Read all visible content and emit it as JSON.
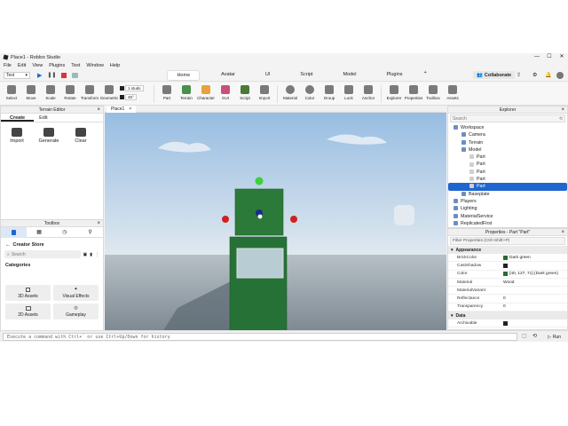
{
  "window": {
    "title": "Place1 - Roblox Studio",
    "controls": [
      "—",
      "☐",
      "✕"
    ]
  },
  "menu": [
    "File",
    "Edit",
    "View",
    "Plugins",
    "Test",
    "Window",
    "Help"
  ],
  "topbar": {
    "mode_select": "Test",
    "tabs": [
      "Home",
      "Avatar",
      "UI",
      "Script",
      "Model",
      "Plugins"
    ],
    "active_tab": "Home",
    "collaborate": "Collaborate"
  },
  "ribbon": {
    "transform_tools": [
      "Select",
      "Move",
      "Scale",
      "Rotate",
      "Transform",
      "Geometric"
    ],
    "snap_move": "1 studs",
    "snap_rotate": "45°",
    "insert_tools": [
      "Part",
      "Terrain",
      "Character",
      "GUI",
      "Script",
      "Import"
    ],
    "edit_tools": [
      "Material",
      "Color",
      "Group",
      "Lock",
      "Anchor"
    ],
    "panels": [
      "Explorer",
      "Properties",
      "Toolbox",
      "Assets"
    ]
  },
  "terrain_editor": {
    "title": "Terrain Editor",
    "tabs": [
      "Create",
      "Edit"
    ],
    "active_tab": "Create",
    "tools": [
      "Import",
      "Generate",
      "Clear"
    ]
  },
  "viewport": {
    "tab": "Place1",
    "sky_color": "#bcd3ea",
    "floor_color": "#8e9aa3",
    "part_color": "#286c2f"
  },
  "toolbox": {
    "title": "Toolbox",
    "store_title": "Creator Store",
    "search_placeholder": "Search",
    "categories_label": "Categories",
    "categories": [
      "3D Assets",
      "Visual Effects",
      "2D Assets",
      "Gameplay"
    ]
  },
  "explorer": {
    "title": "Explorer",
    "search_placeholder": "Search",
    "tree": [
      {
        "label": "Workspace",
        "depth": 0
      },
      {
        "label": "Camera",
        "depth": 1
      },
      {
        "label": "Terrain",
        "depth": 1
      },
      {
        "label": "Model",
        "depth": 1
      },
      {
        "label": "Part",
        "depth": 2
      },
      {
        "label": "Part",
        "depth": 2
      },
      {
        "label": "Part",
        "depth": 2
      },
      {
        "label": "Part",
        "depth": 2
      },
      {
        "label": "Part",
        "depth": 2,
        "selected": true
      },
      {
        "label": "Baseplate",
        "depth": 1
      },
      {
        "label": "Players",
        "depth": 0
      },
      {
        "label": "Lighting",
        "depth": 0
      },
      {
        "label": "MaterialService",
        "depth": 0
      },
      {
        "label": "ReplicatedFirst",
        "depth": 0
      }
    ]
  },
  "properties": {
    "title": "Properties - Part \"Part\"",
    "filter_placeholder": "Filter Properties (Ctrl+Shift+P)",
    "section": "Appearance",
    "section_data": "Data",
    "rows": [
      {
        "key": "BrickColor",
        "value": "Dark green"
      },
      {
        "key": "CastShadow",
        "value": ""
      },
      {
        "key": "Color",
        "value": "[40, 127, 71] (Dark green)"
      },
      {
        "key": "Material",
        "value": "Wood"
      },
      {
        "key": "MaterialVariant",
        "value": ""
      },
      {
        "key": "Reflectance",
        "value": "0"
      },
      {
        "key": "Transparency",
        "value": "0"
      }
    ],
    "data_rows": [
      {
        "key": "Archivable",
        "value": ""
      }
    ]
  },
  "command_bar": {
    "placeholder": "Execute a command with Ctrl+` or use Ctrl+Up/Down for history",
    "run_label": "Run"
  }
}
